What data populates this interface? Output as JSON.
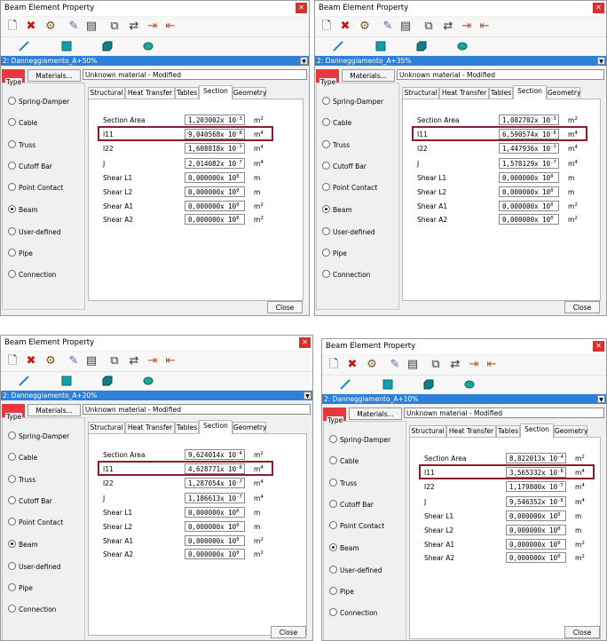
{
  "windows": [
    {
      "title": "Beam Element Property",
      "combo": "2: Danneggiamento_A+50%",
      "material_button": "Materials...",
      "material_name": "Unknown material - Modified",
      "type_label": "Type",
      "types": [
        "Spring-Damper",
        "Cable",
        "Truss",
        "Cutoff Bar",
        "Point Contact",
        "Beam",
        "User-defined",
        "Pipe",
        "Connection"
      ],
      "tabs": [
        "Structural",
        "Heat Transfer",
        "Tables",
        "Section",
        "Geometry"
      ],
      "rows": [
        {
          "label": "Section Area",
          "mant": "1,203002",
          "exp": "-3",
          "unit": "m",
          "unit_exp": "2"
        },
        {
          "label": "I11",
          "mant": "9,040568",
          "exp": "-8",
          "unit": "m",
          "unit_exp": "4"
        },
        {
          "label": "I22",
          "mant": "1,608818",
          "exp": "-7",
          "unit": "m",
          "unit_exp": "4"
        },
        {
          "label": "J",
          "mant": "2,014082",
          "exp": "-7",
          "unit": "m",
          "unit_exp": "4"
        },
        {
          "label": "Shear L1",
          "mant": "0,000000",
          "exp": "0",
          "unit": "m",
          "unit_exp": ""
        },
        {
          "label": "Shear L2",
          "mant": "0,000000",
          "exp": "0",
          "unit": "m",
          "unit_exp": ""
        },
        {
          "label": "Shear A1",
          "mant": "0,000000",
          "exp": "0",
          "unit": "m",
          "unit_exp": "2"
        },
        {
          "label": "Shear A2",
          "mant": "0,000000",
          "exp": "0",
          "unit": "m",
          "unit_exp": "2"
        }
      ],
      "close_label": "Close"
    },
    {
      "title": "Beam Element Property",
      "combo": "2: Danneggiamento_A+35%",
      "material_button": "Materials...",
      "material_name": "Unknown material - Modified",
      "type_label": "Type",
      "types": [
        "Spring-Damper",
        "Cable",
        "Truss",
        "Cutoff Bar",
        "Point Contact",
        "Beam",
        "User-defined",
        "Pipe",
        "Connection"
      ],
      "tabs": [
        "Structural",
        "Heat Transfer",
        "Tables",
        "Section",
        "Geometry"
      ],
      "rows": [
        {
          "label": "Section Area",
          "mant": "1,082702",
          "exp": "-3",
          "unit": "m",
          "unit_exp": "2"
        },
        {
          "label": "I11",
          "mant": "6,590574",
          "exp": "-8",
          "unit": "m",
          "unit_exp": "4"
        },
        {
          "label": "I22",
          "mant": "1,447936",
          "exp": "-7",
          "unit": "m",
          "unit_exp": "4"
        },
        {
          "label": "J",
          "mant": "1,578129",
          "exp": "-7",
          "unit": "m",
          "unit_exp": "4"
        },
        {
          "label": "Shear L1",
          "mant": "0,000000",
          "exp": "0",
          "unit": "m",
          "unit_exp": ""
        },
        {
          "label": "Shear L2",
          "mant": "0,000000",
          "exp": "0",
          "unit": "m",
          "unit_exp": ""
        },
        {
          "label": "Shear A1",
          "mant": "0,000000",
          "exp": "0",
          "unit": "m",
          "unit_exp": "2"
        },
        {
          "label": "Shear A2",
          "mant": "0,000000",
          "exp": "0",
          "unit": "m",
          "unit_exp": "2"
        }
      ],
      "close_label": "Close"
    },
    {
      "title": "Beam Element Property",
      "combo": "2: Danneggiamento_A+20%",
      "material_button": "Materials...",
      "material_name": "Unknown material - Modified",
      "type_label": "Type",
      "types": [
        "Spring-Damper",
        "Cable",
        "Truss",
        "Cutoff Bar",
        "Point Contact",
        "Beam",
        "User-defined",
        "Pipe",
        "Connection"
      ],
      "tabs": [
        "Structural",
        "Heat Transfer",
        "Tables",
        "Section",
        "Geometry"
      ],
      "rows": [
        {
          "label": "Section Area",
          "mant": "9,624014",
          "exp": "-4",
          "unit": "m",
          "unit_exp": "2"
        },
        {
          "label": "I11",
          "mant": "4,628771",
          "exp": "-8",
          "unit": "m",
          "unit_exp": "4"
        },
        {
          "label": "I22",
          "mant": "1,287054",
          "exp": "-7",
          "unit": "m",
          "unit_exp": "4"
        },
        {
          "label": "J",
          "mant": "1,186613",
          "exp": "-7",
          "unit": "m",
          "unit_exp": "4"
        },
        {
          "label": "Shear L1",
          "mant": "0,000000",
          "exp": "0",
          "unit": "m",
          "unit_exp": ""
        },
        {
          "label": "Shear L2",
          "mant": "0,000000",
          "exp": "0",
          "unit": "m",
          "unit_exp": ""
        },
        {
          "label": "Shear A1",
          "mant": "0,000000",
          "exp": "0",
          "unit": "m",
          "unit_exp": "2"
        },
        {
          "label": "Shear A2",
          "mant": "0,000000",
          "exp": "0",
          "unit": "m",
          "unit_exp": "2"
        }
      ],
      "close_label": "Close"
    },
    {
      "title": "Beam Element Property",
      "combo": "2: Danneggiamento_A+10%",
      "material_button": "Materials...",
      "material_name": "Unknown material - Modified",
      "type_label": "Type",
      "types": [
        "Spring-Damper",
        "Cable",
        "Truss",
        "Cutoff Bar",
        "Point Contact",
        "Beam",
        "User-defined",
        "Pipe",
        "Connection"
      ],
      "tabs": [
        "Structural",
        "Heat Transfer",
        "Tables",
        "Section",
        "Geometry"
      ],
      "rows": [
        {
          "label": "Section Area",
          "mant": "8,822013",
          "exp": "-4",
          "unit": "m",
          "unit_exp": "2"
        },
        {
          "label": "I11",
          "mant": "3,565332",
          "exp": "-8",
          "unit": "m",
          "unit_exp": "4"
        },
        {
          "label": "I22",
          "mant": "1,179800",
          "exp": "-7",
          "unit": "m",
          "unit_exp": "4"
        },
        {
          "label": "J",
          "mant": "9,546352",
          "exp": "-8",
          "unit": "m",
          "unit_exp": "4"
        },
        {
          "label": "Shear L1",
          "mant": "0,000000",
          "exp": "0",
          "unit": "m",
          "unit_exp": ""
        },
        {
          "label": "Shear L2",
          "mant": "0,000000",
          "exp": "0",
          "unit": "m",
          "unit_exp": ""
        },
        {
          "label": "Shear A1",
          "mant": "0,000000",
          "exp": "0",
          "unit": "m",
          "unit_exp": "2"
        },
        {
          "label": "Shear A2",
          "mant": "0,000000",
          "exp": "0",
          "unit": "m",
          "unit_exp": "2"
        }
      ],
      "close_label": "Close"
    }
  ],
  "common": {
    "times_sign": "x 10",
    "selected_type": "Beam",
    "active_tab": "Section",
    "highlight_row": "I11",
    "highlight_color": "#8a1c2c",
    "combo_color": "#2d7fd8",
    "material_swatch_color": "#e8383d",
    "toolbar_icons": [
      "new-icon",
      "delete-icon",
      "copy-properties-icon",
      "edit-icon",
      "manage-icon",
      "duplicate-icon",
      "transfer-icon",
      "import-icon",
      "export-icon"
    ],
    "toolbar2_icons": [
      "line-element-icon",
      "plate-element-icon",
      "brick-element-icon",
      "solid-element-icon"
    ]
  }
}
